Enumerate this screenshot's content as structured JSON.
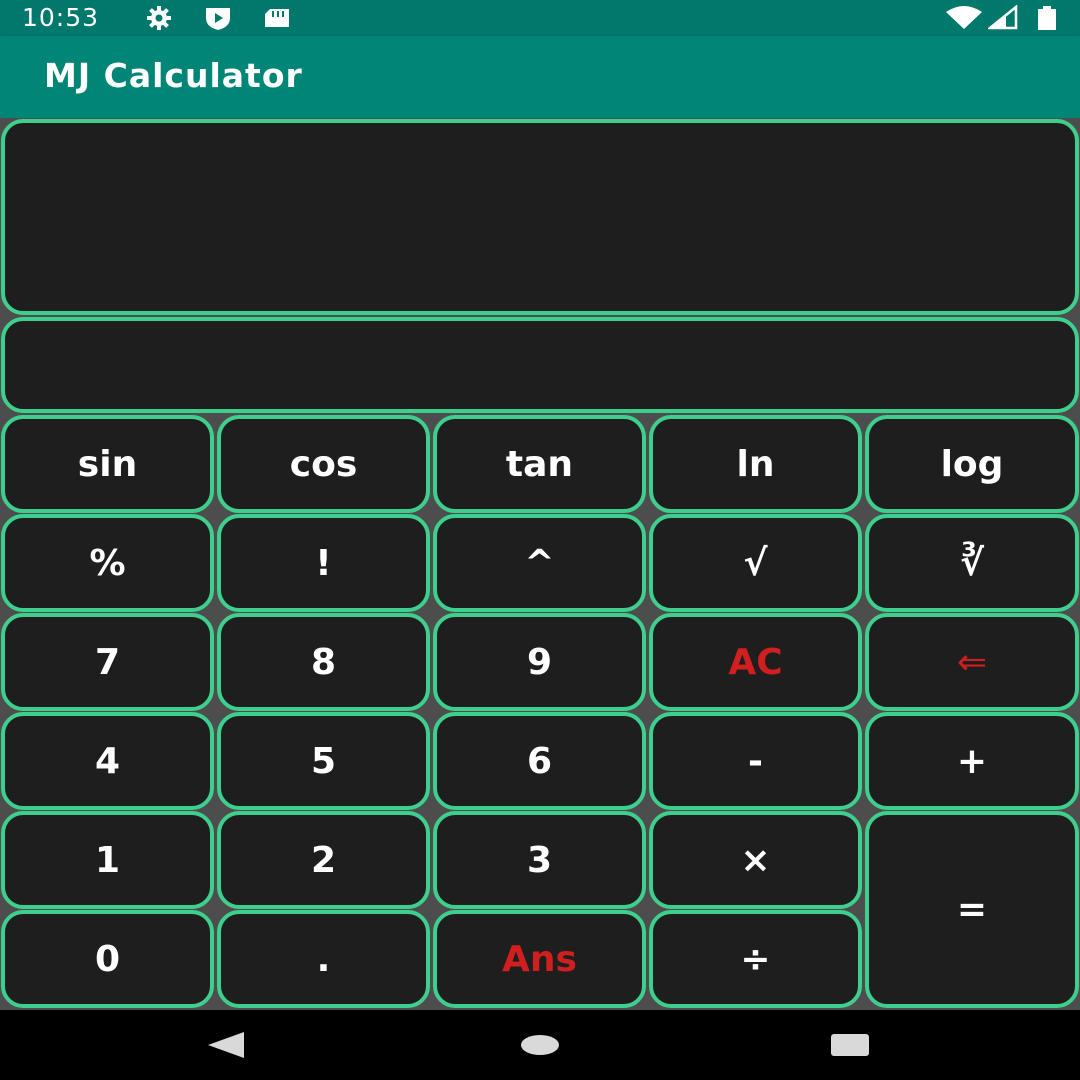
{
  "status_bar": {
    "time": "10:53",
    "icons": [
      "gear-icon",
      "play-protect-icon",
      "sd-card-icon",
      "wifi-icon",
      "signal-icon",
      "battery-icon"
    ]
  },
  "app_bar": {
    "title": "MJ Calculator",
    "color": "#008577"
  },
  "display": {
    "expression": "",
    "result": ""
  },
  "keys": {
    "sin": "sin",
    "cos": "cos",
    "tan": "tan",
    "ln": "ln",
    "log": "log",
    "percent": "%",
    "factorial": "!",
    "power": "^",
    "sqrt": "√",
    "cbrt": "∛",
    "seven": "7",
    "eight": "8",
    "nine": "9",
    "clear": "AC",
    "backspace": "⇐",
    "four": "4",
    "five": "5",
    "six": "6",
    "minus": "-",
    "plus": "+",
    "one": "1",
    "two": "2",
    "three": "3",
    "multiply": "×",
    "equals": "=",
    "zero": "0",
    "decimal": ".",
    "answer": "Ans",
    "divide": "÷"
  },
  "colors": {
    "key_border": "#3ecf8e",
    "key_background": "#1e1e1e",
    "accent_red": "#d01f1f",
    "background": "#4d4d4d"
  },
  "nav_bar": {
    "icons": [
      "back-icon",
      "home-icon",
      "recents-icon"
    ]
  }
}
